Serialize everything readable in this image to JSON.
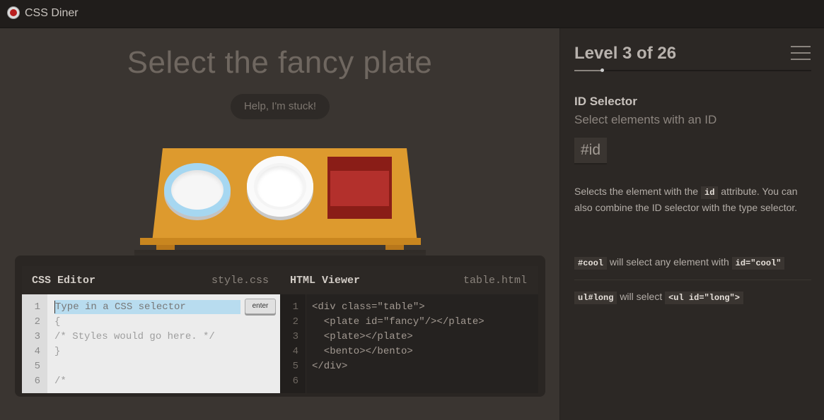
{
  "app": {
    "title": "CSS Diner"
  },
  "main": {
    "instruction": "Select the fancy plate",
    "help_label": "Help, I'm stuck!"
  },
  "css_editor": {
    "title": "CSS Editor",
    "filename": "style.css",
    "input_placeholder": "Type in a CSS selector",
    "enter_label": "enter",
    "line_numbers": [
      "1",
      "2",
      "3",
      "4",
      "5",
      "6"
    ],
    "lines": [
      "",
      "{",
      "/* Styles would go here. */",
      "}",
      "",
      "/*"
    ]
  },
  "html_viewer": {
    "title": "HTML Viewer",
    "filename": "table.html",
    "line_numbers": [
      "1",
      "2",
      "3",
      "4",
      "5",
      "6"
    ],
    "lines": [
      "<div class=\"table\">",
      "  <plate id=\"fancy\"/></plate>",
      "  <plate></plate>",
      "  <bento></bento>",
      "</div>",
      ""
    ]
  },
  "sidebar": {
    "level_label": "Level 3 of 26",
    "progress_fraction": 0.115,
    "selector_name": "ID Selector",
    "selector_desc": "Select elements with an ID",
    "syntax": "#id",
    "description_before": "Selects the element with the ",
    "description_code": "id",
    "description_after": " attribute. You can also combine the ID selector with the type selector.",
    "examples": [
      {
        "code": "#cool",
        "text": "will select any element with",
        "code2": "id=\"cool\""
      },
      {
        "code": "ul#long",
        "text": "will select",
        "code2": "<ul id=\"long\">"
      }
    ]
  },
  "colors": {
    "background": "#3a3531",
    "sidebar": "#2c2825",
    "table": "#dd9a2e",
    "fancy_plate_rim": "#a6d7f1",
    "bento": "#8a1d17"
  },
  "icons": {
    "logo": "tomato-logo-icon",
    "menu": "hamburger-menu-icon"
  }
}
